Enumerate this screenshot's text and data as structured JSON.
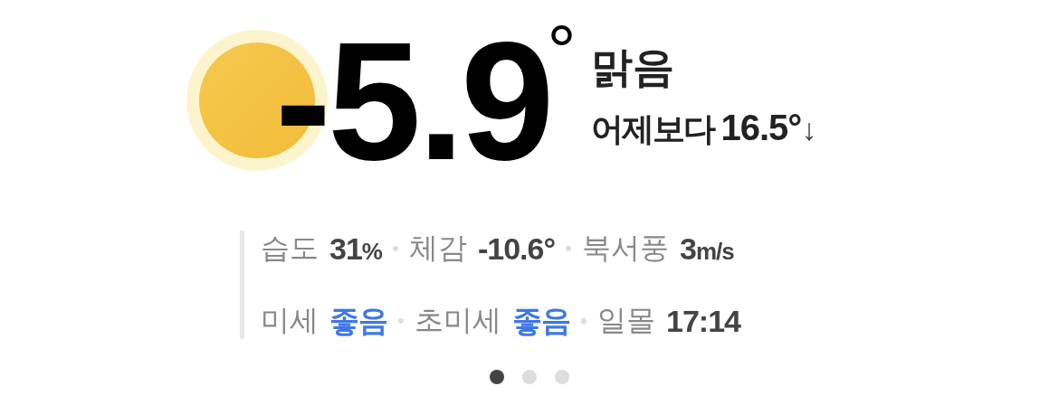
{
  "current": {
    "temperature": "-5.9",
    "degree": "°",
    "condition": "맑음",
    "comparison_label": "어제보다",
    "comparison_value": "16.5°",
    "trend_arrow": "↓"
  },
  "details": [
    [
      {
        "label": "습도",
        "value": "31",
        "unit": "%",
        "kind": "reading"
      },
      {
        "label": "체감",
        "value": "-10.6°",
        "kind": "reading"
      },
      {
        "label": "북서풍",
        "value": "3",
        "unit": "m/s",
        "kind": "reading"
      }
    ],
    [
      {
        "label": "미세",
        "value": "좋음",
        "kind": "status"
      },
      {
        "label": "초미세",
        "value": "좋음",
        "kind": "status"
      },
      {
        "label": "일몰",
        "value": "17:14",
        "kind": "reading"
      }
    ]
  ],
  "pages": [
    {
      "selected": true
    },
    {
      "selected": false
    },
    {
      "selected": false
    }
  ]
}
